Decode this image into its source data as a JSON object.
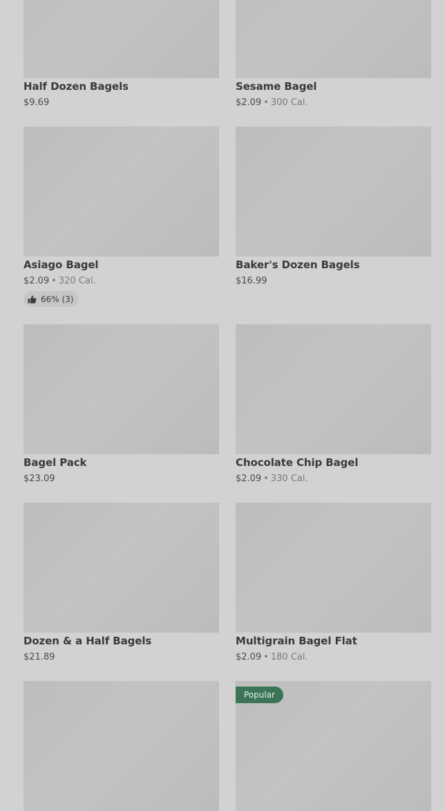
{
  "products": [
    {
      "name": "Half Dozen Bagels",
      "price": "$9.69",
      "cal": ""
    },
    {
      "name": "Sesame Bagel",
      "price": "$2.09",
      "cal": "300 Cal."
    },
    {
      "name": "Asiago Bagel",
      "price": "$2.09",
      "cal": "320 Cal.",
      "rating": "66% (3)"
    },
    {
      "name": "Baker's Dozen Bagels",
      "price": "$16.99",
      "cal": ""
    },
    {
      "name": "Bagel Pack",
      "price": "$23.09",
      "cal": ""
    },
    {
      "name": "Chocolate Chip Bagel",
      "price": "$2.09",
      "cal": "330 Cal."
    },
    {
      "name": "Dozen & a Half Bagels",
      "price": "$21.89",
      "cal": ""
    },
    {
      "name": "Multigrain Bagel Flat",
      "price": "$2.09",
      "cal": "180 Cal."
    },
    {
      "name": "",
      "price": "",
      "cal": ""
    },
    {
      "name": "",
      "price": "",
      "cal": "",
      "badge": "Popular"
    }
  ],
  "separator": "•",
  "icons": {
    "rating": "thumbs-up-icon"
  },
  "colors": {
    "popular_badge": "#3b7556"
  }
}
